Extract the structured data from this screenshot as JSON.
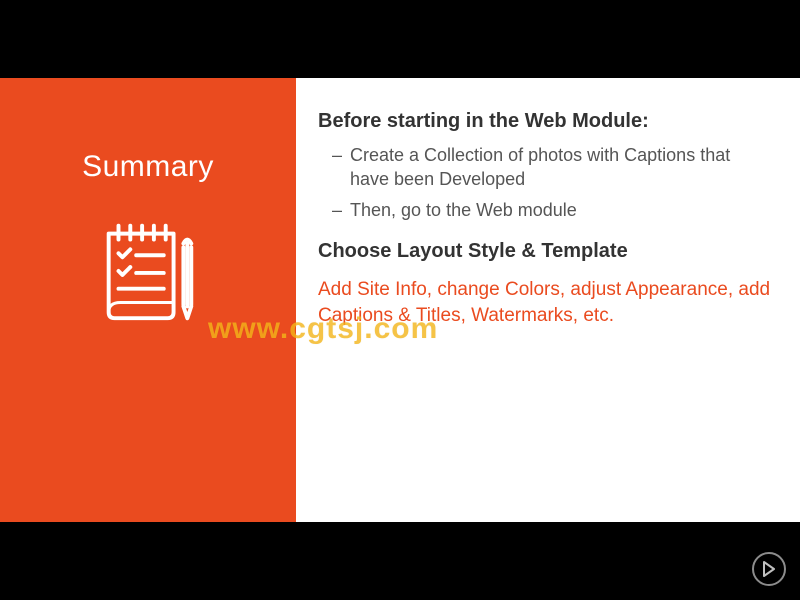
{
  "leftPanel": {
    "title": "Summary"
  },
  "content": {
    "heading1": "Before starting in the Web Module:",
    "bullets": [
      "Create a Collection of photos with Captions that have been Developed",
      "Then, go to the Web module"
    ],
    "heading2": "Choose Layout Style & Template",
    "highlighted": "Add Site Info, change Colors, adjust Appearance, add Captions & Titles, Watermarks, etc."
  },
  "watermark": "www.cgtsj.com",
  "colors": {
    "accent": "#ea4b1f",
    "watermark": "#f3b51a"
  }
}
